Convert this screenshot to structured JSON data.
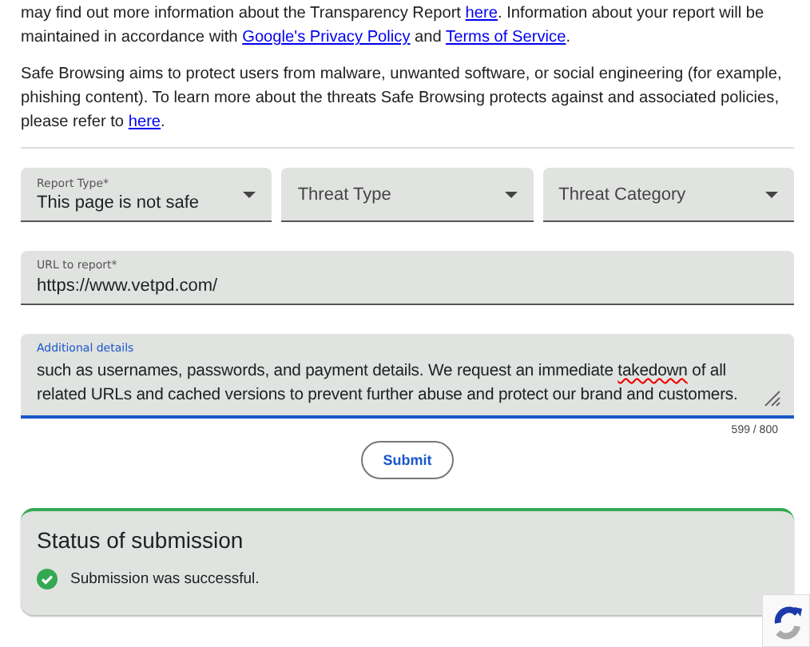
{
  "intro_paragraphs": [
    [
      {
        "text": "may find out more information about the Transparency Report ",
        "link": false
      },
      {
        "text": "here",
        "link": true
      },
      {
        "text": ". Information about your report will be maintained in accordance with ",
        "link": false
      },
      {
        "text": "Google's Privacy Policy",
        "link": true
      },
      {
        "text": " and ",
        "link": false
      },
      {
        "text": "Terms of Service",
        "link": true
      },
      {
        "text": ".",
        "link": false
      }
    ],
    [
      {
        "text": "Safe Browsing aims to protect users from malware, unwanted software, or social engineering (for example, phishing content). To learn more about the threats Safe Browsing protects against and associated policies, please refer to ",
        "link": false
      },
      {
        "text": "here",
        "link": true
      },
      {
        "text": ".",
        "link": false
      }
    ]
  ],
  "selects": [
    {
      "label": "Report Type*",
      "value": "This page is not safe"
    },
    {
      "label": "Threat Type"
    },
    {
      "label": "Threat Category"
    }
  ],
  "url_field": {
    "label": "URL to report*",
    "value": "https://www.vetpd.com/",
    "focused": false
  },
  "details_field": {
    "label": "Additional details",
    "focused": true,
    "value": [
      {
        "text": "such as usernames, passwords, and payment details. We request an immediate ",
        "misspelled": false
      },
      {
        "text": "takedown",
        "misspelled": true
      },
      {
        "text": " of all related URLs and cached versions to prevent further abuse and protect our brand and customers.",
        "misspelled": false
      }
    ],
    "counter": "599 / 800"
  },
  "submit_button": "Submit",
  "status": {
    "title": "Status of submission",
    "message": "Submission was successful.",
    "success": true
  }
}
